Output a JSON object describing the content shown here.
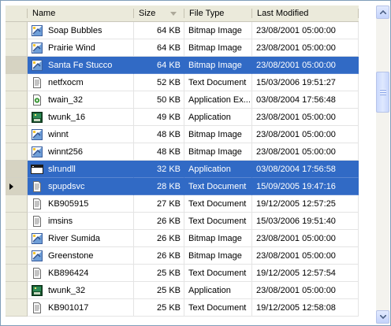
{
  "columns": {
    "name": "Name",
    "size": "Size",
    "type": "File Type",
    "modified": "Last Modified"
  },
  "sort": {
    "column": "size",
    "direction": "descending"
  },
  "colors": {
    "selection": "#316ac5",
    "header": "#ebeadb",
    "border": "#7f9db9"
  },
  "rows": [
    {
      "name": "Soap Bubbles",
      "size": "64 KB",
      "type": "Bitmap Image",
      "modified": "23/08/2001 05:00:00",
      "icon": "bitmap-icon",
      "selected": false
    },
    {
      "name": "Prairie Wind",
      "size": "64 KB",
      "type": "Bitmap Image",
      "modified": "23/08/2001 05:00:00",
      "icon": "bitmap-icon",
      "selected": false
    },
    {
      "name": "Santa Fe Stucco",
      "size": "64 KB",
      "type": "Bitmap Image",
      "modified": "23/08/2001 05:00:00",
      "icon": "bitmap-icon",
      "selected": true
    },
    {
      "name": "netfxocm",
      "size": "52 KB",
      "type": "Text Document",
      "modified": "15/03/2006 19:51:27",
      "icon": "text-document-icon",
      "selected": false
    },
    {
      "name": "twain_32",
      "size": "50 KB",
      "type": "Application Ex...",
      "modified": "03/08/2004 17:56:48",
      "icon": "application-extension-icon",
      "selected": false
    },
    {
      "name": "twunk_16",
      "size": "49 KB",
      "type": "Application",
      "modified": "23/08/2001 05:00:00",
      "icon": "scanner-application-icon",
      "selected": false
    },
    {
      "name": "winnt",
      "size": "48 KB",
      "type": "Bitmap Image",
      "modified": "23/08/2001 05:00:00",
      "icon": "bitmap-icon",
      "selected": false
    },
    {
      "name": "winnt256",
      "size": "48 KB",
      "type": "Bitmap Image",
      "modified": "23/08/2001 05:00:00",
      "icon": "bitmap-icon",
      "selected": false
    },
    {
      "name": "slrundll",
      "size": "32 KB",
      "type": "Application",
      "modified": "03/08/2004 17:56:58",
      "icon": "application-window-icon",
      "selected": true
    },
    {
      "name": "spupdsvc",
      "size": "28 KB",
      "type": "Text Document",
      "modified": "15/09/2005 19:47:16",
      "icon": "text-document-icon",
      "selected": true,
      "current": true
    },
    {
      "name": "KB905915",
      "size": "27 KB",
      "type": "Text Document",
      "modified": "19/12/2005 12:57:25",
      "icon": "text-document-icon",
      "selected": false
    },
    {
      "name": "imsins",
      "size": "26 KB",
      "type": "Text Document",
      "modified": "15/03/2006 19:51:40",
      "icon": "text-document-icon",
      "selected": false
    },
    {
      "name": "River Sumida",
      "size": "26 KB",
      "type": "Bitmap Image",
      "modified": "23/08/2001 05:00:00",
      "icon": "bitmap-icon",
      "selected": false
    },
    {
      "name": "Greenstone",
      "size": "26 KB",
      "type": "Bitmap Image",
      "modified": "23/08/2001 05:00:00",
      "icon": "bitmap-icon",
      "selected": false
    },
    {
      "name": "KB896424",
      "size": "25 KB",
      "type": "Text Document",
      "modified": "19/12/2005 12:57:54",
      "icon": "text-document-icon",
      "selected": false
    },
    {
      "name": "twunk_32",
      "size": "25 KB",
      "type": "Application",
      "modified": "23/08/2001 05:00:00",
      "icon": "scanner-application-icon",
      "selected": false
    },
    {
      "name": "KB901017",
      "size": "25 KB",
      "type": "Text Document",
      "modified": "19/12/2005 12:58:08",
      "icon": "text-document-icon",
      "selected": false
    }
  ]
}
